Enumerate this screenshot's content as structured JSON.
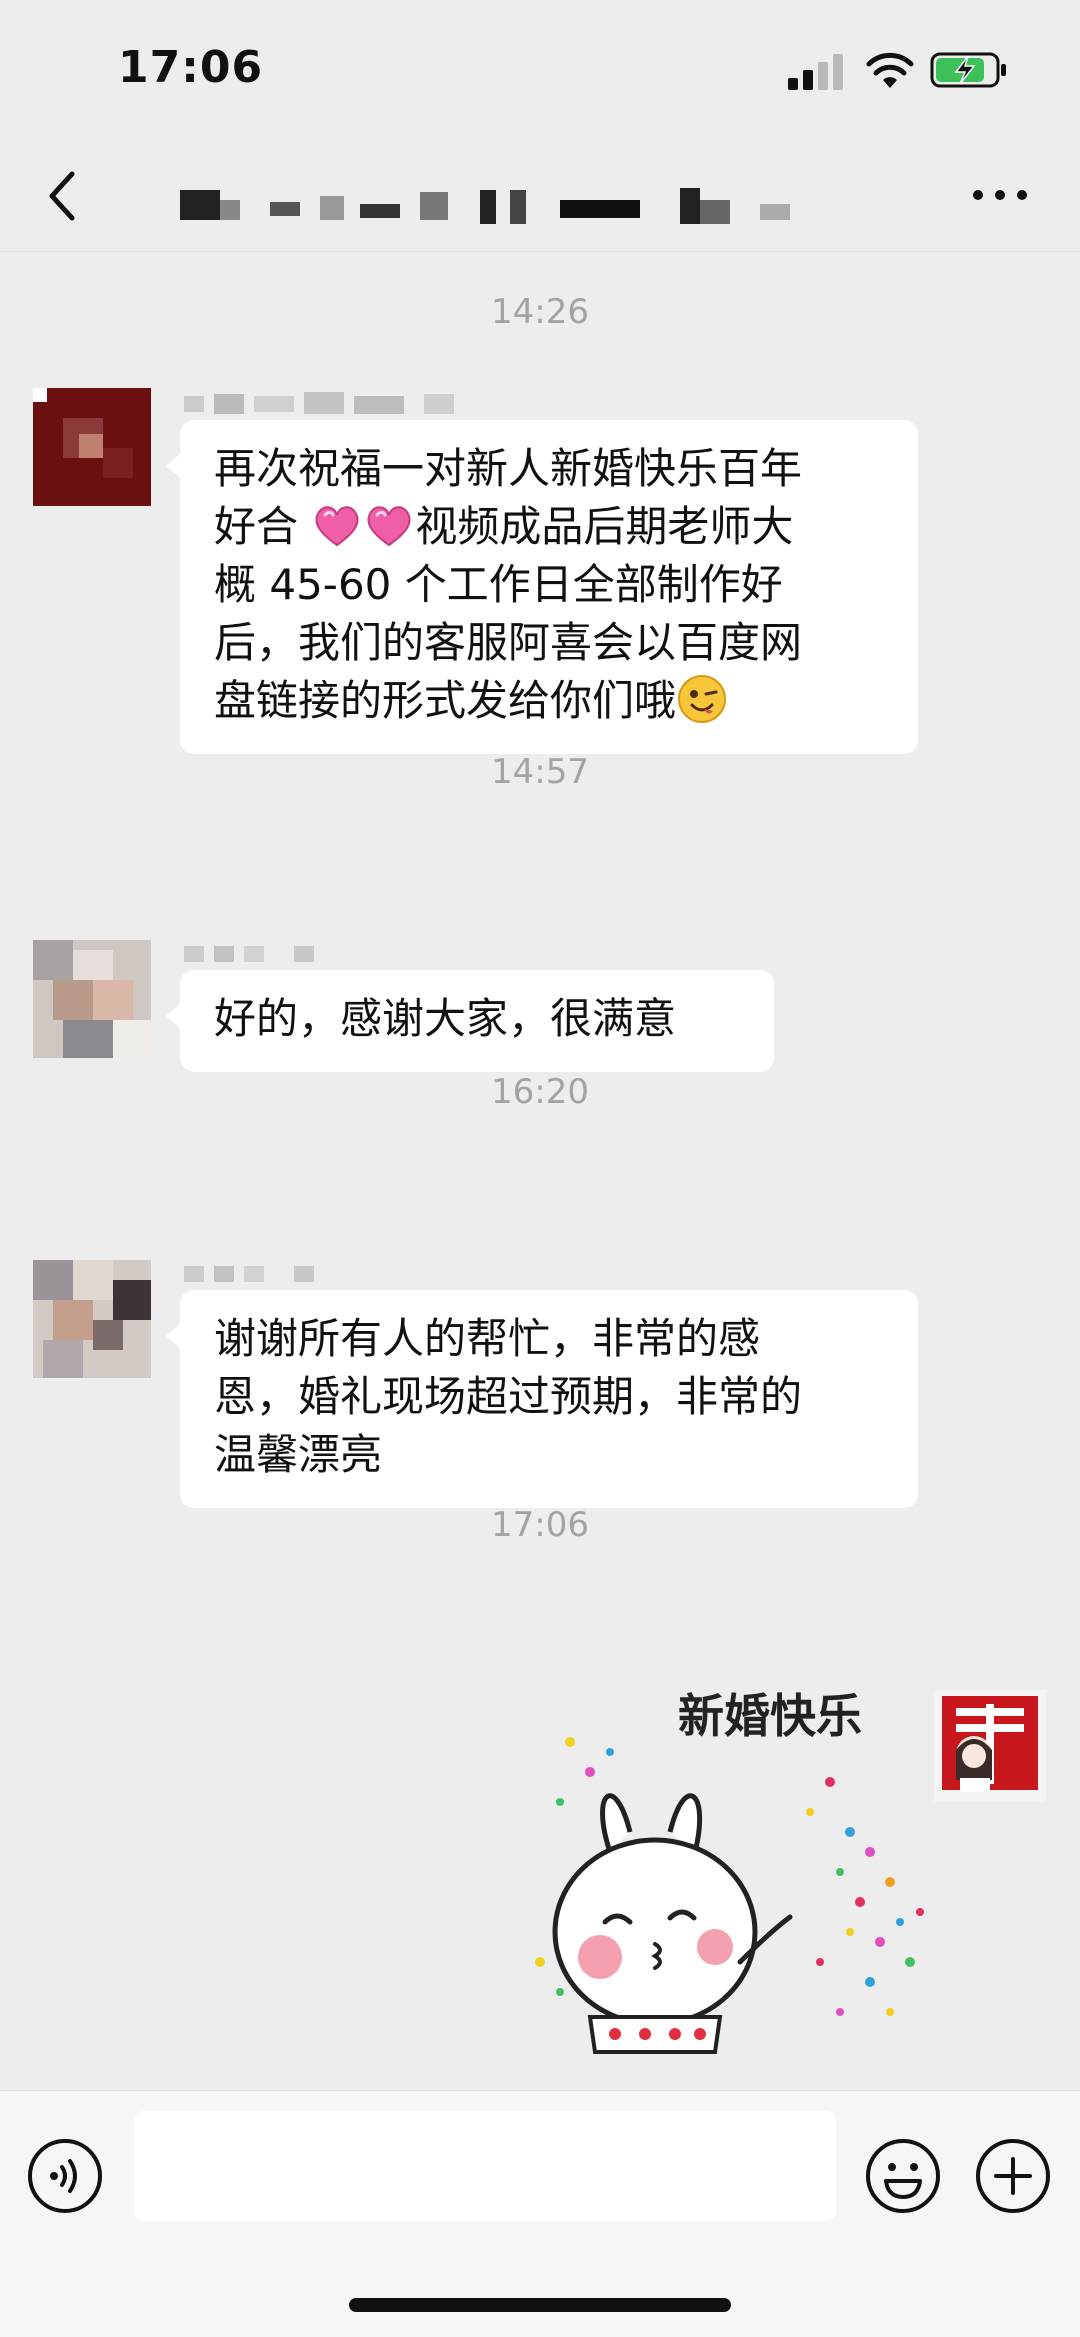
{
  "status_bar": {
    "time": "17:06"
  },
  "nav": {
    "back_icon": "chevron-left-icon",
    "more_icon": "ellipsis-icon"
  },
  "messages": [
    {
      "timestamp": "14:26",
      "text_part1": "再次祝福一对新人新婚快乐百年\n好合 ",
      "text_part2": "视频成品后期老师大\n概 45-60 个工作日全部制作好\n后，我们的客服阿喜会以百度网\n盘链接的形式发给你们哦"
    },
    {
      "timestamp": "14:57",
      "text": "好的，感谢大家，很满意"
    },
    {
      "timestamp": "16:20",
      "text": "谢谢所有人的帮忙，非常的感\n恩，婚礼现场超过预期，非常的\n温馨漂亮"
    },
    {
      "timestamp": "17:06",
      "sticker_text": "新婚快乐"
    }
  ],
  "input_bar": {
    "placeholder": ""
  },
  "colors": {
    "background": "#ededed",
    "bubble": "#ffffff",
    "timestamp": "#a3a3a3"
  }
}
